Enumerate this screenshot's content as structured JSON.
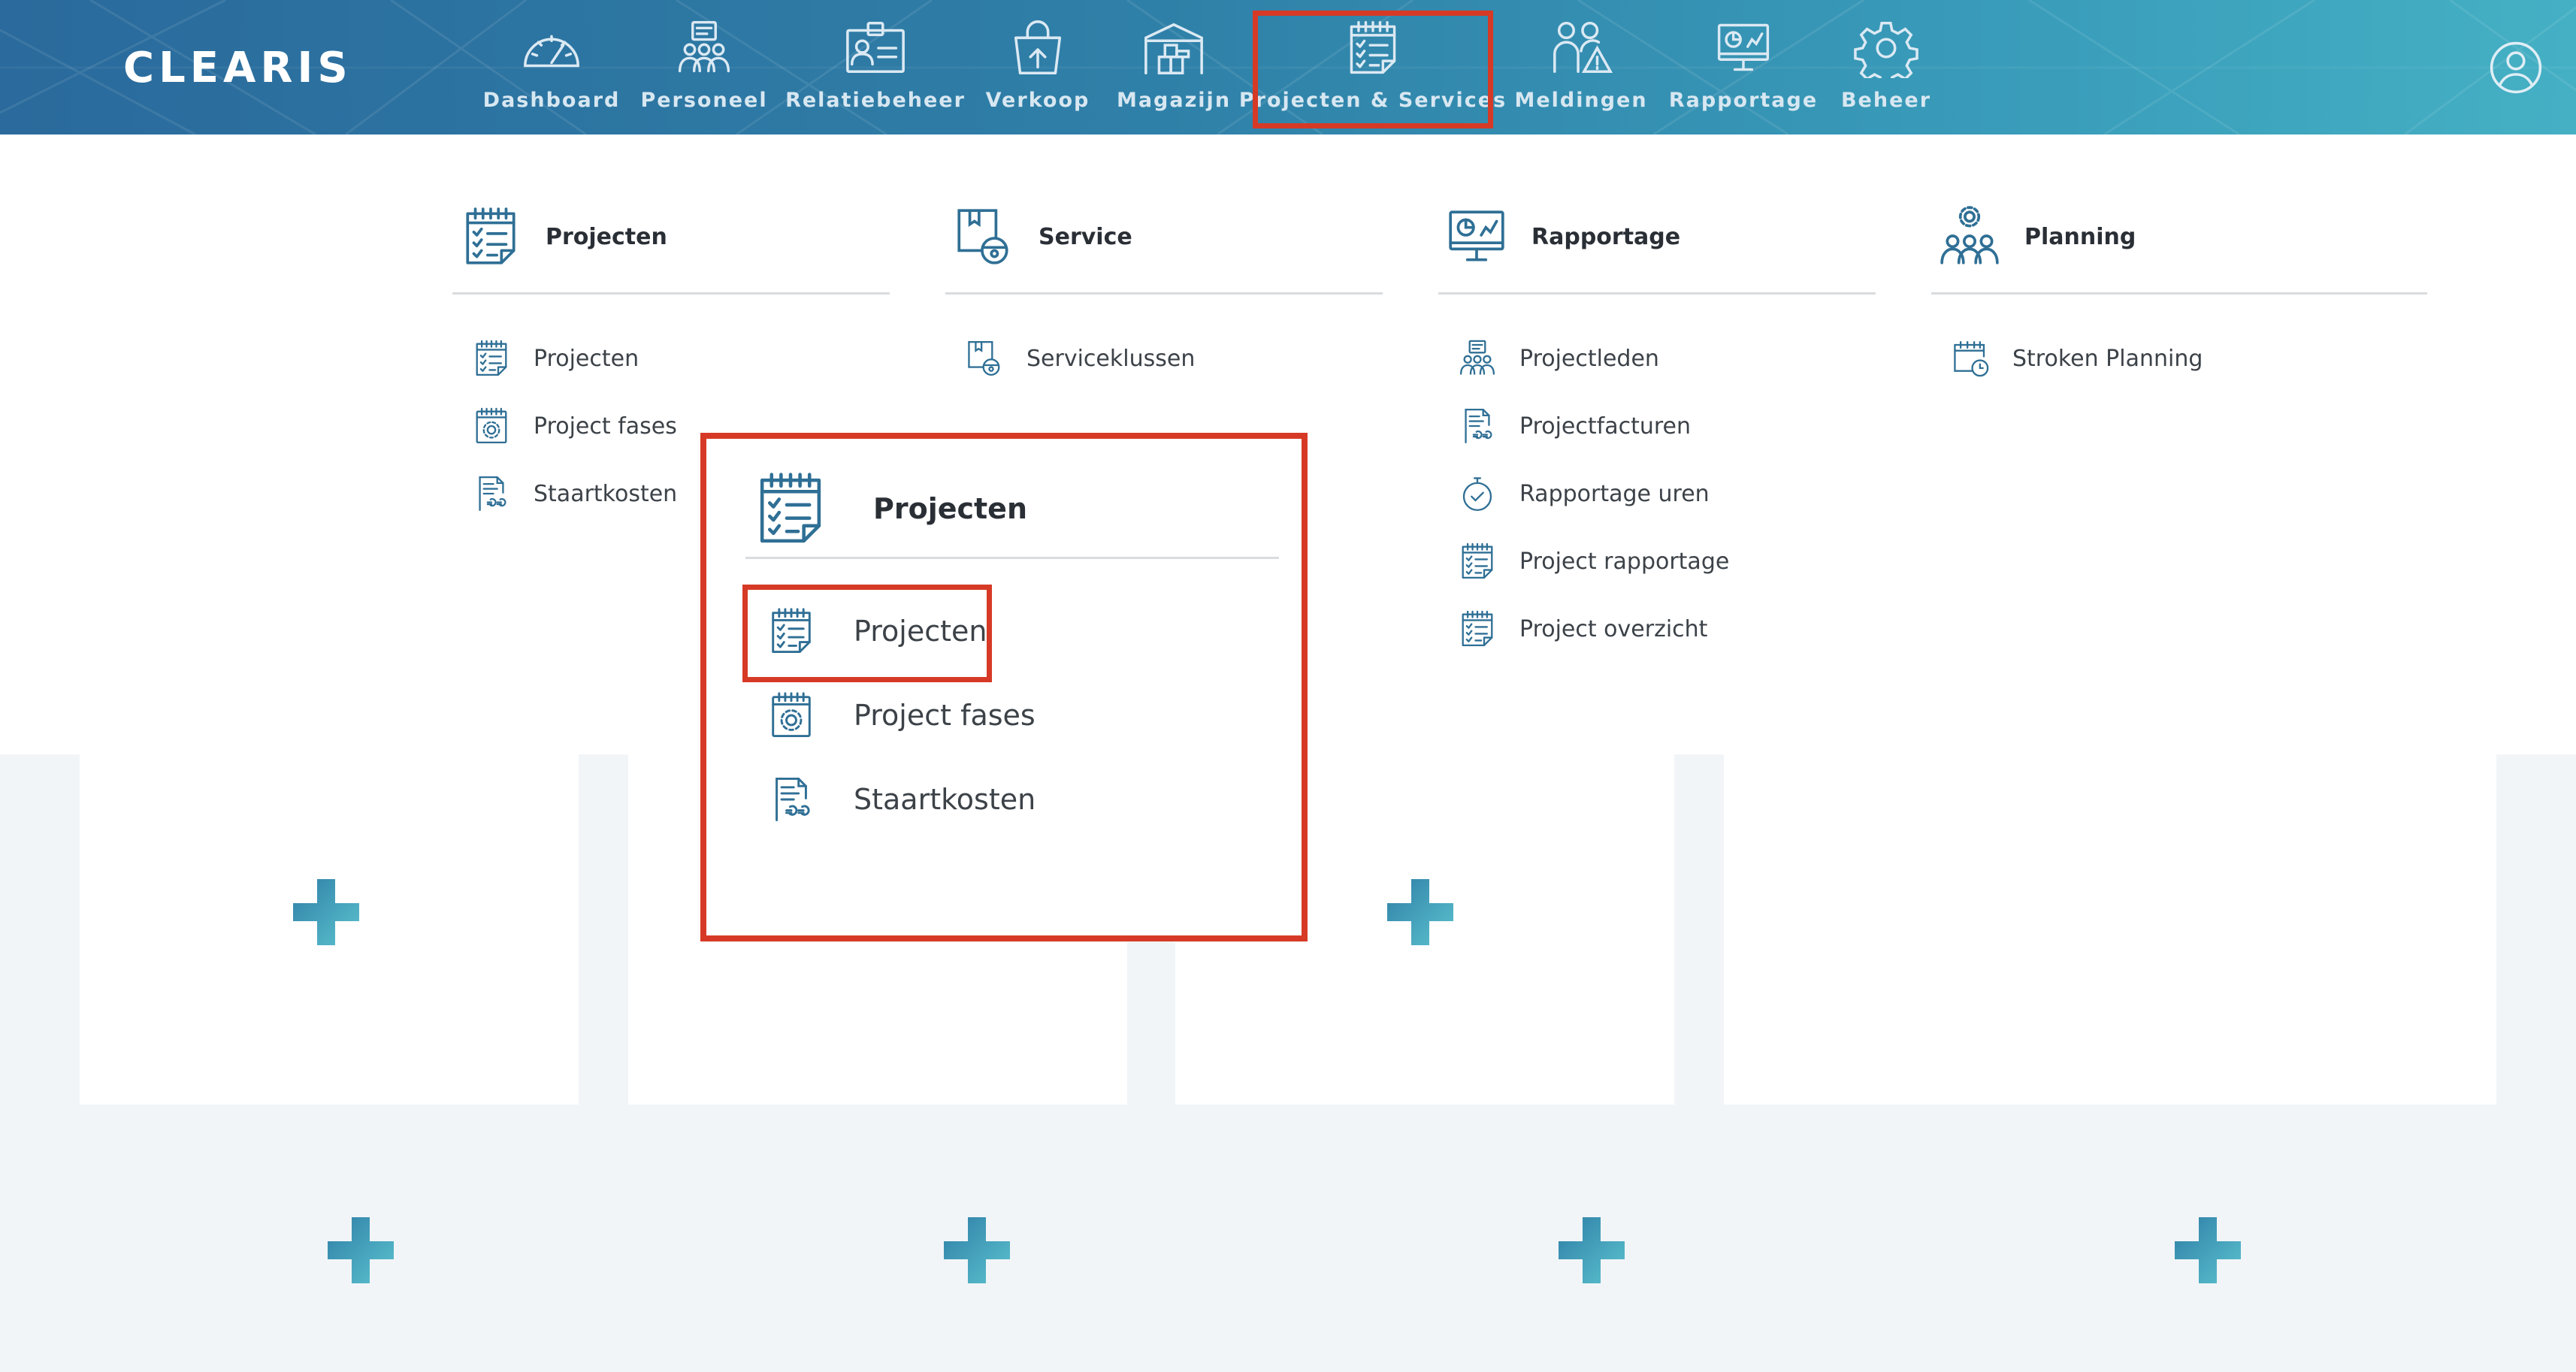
{
  "app": {
    "name": "CLEARIS"
  },
  "topnav": {
    "items": [
      {
        "label": "Dashboard",
        "icon": "speedometer-icon"
      },
      {
        "label": "Personeel",
        "icon": "people-icon"
      },
      {
        "label": "Relatiebeheer",
        "icon": "contact-card-icon"
      },
      {
        "label": "Verkoop",
        "icon": "shopping-bag-icon"
      },
      {
        "label": "Magazijn",
        "icon": "warehouse-icon"
      },
      {
        "label": "Projecten & Services",
        "icon": "checklist-icon",
        "active": true
      },
      {
        "label": "Meldingen",
        "icon": "alert-people-icon"
      },
      {
        "label": "Rapportage",
        "icon": "monitor-chart-icon"
      },
      {
        "label": "Beheer",
        "icon": "gear-icon"
      }
    ],
    "user_icon": "user-icon"
  },
  "menu": {
    "columns": [
      {
        "title": "Projecten",
        "icon": "checklist-icon",
        "links": [
          {
            "label": "Projecten",
            "icon": "checklist-icon"
          },
          {
            "label": "Project fases",
            "icon": "calendar-gear-icon"
          },
          {
            "label": "Staartkosten",
            "icon": "invoice-euro-icon"
          }
        ]
      },
      {
        "title": "Service",
        "icon": "service-icon",
        "links": [
          {
            "label": "Serviceklussen",
            "icon": "service-icon"
          }
        ]
      },
      {
        "title": "Rapportage",
        "icon": "monitor-chart-icon",
        "links": [
          {
            "label": "Projectleden",
            "icon": "people-icon"
          },
          {
            "label": "Projectfacturen",
            "icon": "invoice-euro-icon"
          },
          {
            "label": "Rapportage uren",
            "icon": "stopwatch-icon"
          },
          {
            "label": "Project rapportage",
            "icon": "checklist-icon"
          },
          {
            "label": "Project overzicht",
            "icon": "checklist-icon"
          }
        ]
      },
      {
        "title": "Planning",
        "icon": "team-gear-icon",
        "links": [
          {
            "label": "Stroken Planning",
            "icon": "calendar-clock-icon"
          }
        ]
      }
    ]
  },
  "callout": {
    "title": "Projecten",
    "links": [
      {
        "label": "Projecten",
        "selected": true
      },
      {
        "label": "Project fases"
      },
      {
        "label": "Staartkosten"
      }
    ]
  },
  "colors": {
    "highlight": "#d63a26",
    "brand_dark": "#2a6a9c",
    "brand_light": "#45b0c4",
    "icon": "#2f6f95"
  }
}
